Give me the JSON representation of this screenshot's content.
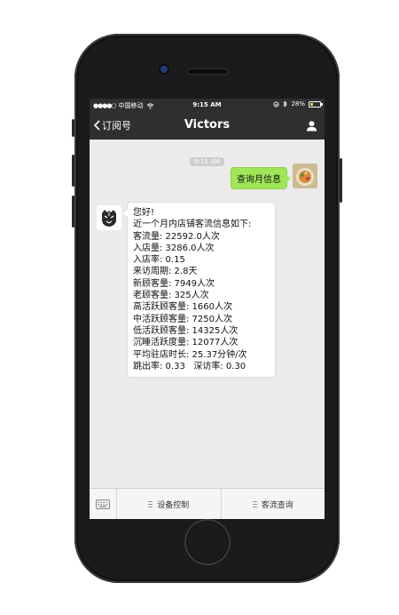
{
  "status_bar": {
    "carrier": "中国移动",
    "time": "9:15 AM",
    "battery": "28%",
    "battery_level": 0.28
  },
  "nav": {
    "back_label": "订阅号",
    "title": "Victors"
  },
  "chat": {
    "timestamp": "9:15 AM",
    "outgoing_message": "查询月信息",
    "reply_lines": [
      "您好!",
      "近一个月内店铺客流信息如下:",
      "客流量: 22592.0人次",
      "入店量: 3286.0人次",
      "入店率: 0.15",
      "来访周期: 2.8天",
      "新顾客量: 7949人次",
      "老顾客量: 325人次",
      "高活跃顾客量: 1660人次",
      "中活跃顾客量: 7250人次",
      "低活跃顾客量: 14325人次",
      "沉睡活跃度量: 12077人次",
      "平均驻店时长: 25.37分钟/次",
      "跳出率: 0.33   深访率: 0.30"
    ]
  },
  "bottom_menu": {
    "items": [
      "设备控制",
      "客流查询"
    ]
  },
  "colors": {
    "nav_bg": "#2f2f31",
    "chat_bg": "#ebebeb",
    "outgoing_bubble": "#9fe658",
    "incoming_bubble": "#ffffff"
  },
  "icons": {
    "back": "chevron-left-icon",
    "user": "user-icon",
    "keyboard": "keyboard-icon",
    "menu": "menu-icon"
  }
}
